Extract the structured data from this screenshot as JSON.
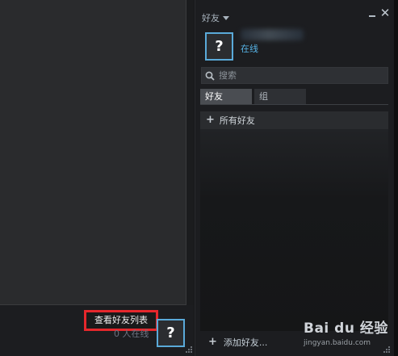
{
  "main_window": {
    "view_friends_label": "查看好友列表",
    "online_count": "0 人在线",
    "avatar_placeholder": "?"
  },
  "friends_panel": {
    "title": "好友",
    "self": {
      "avatar_placeholder": "?",
      "status": "在线"
    },
    "search": {
      "placeholder": "搜索"
    },
    "tabs": [
      {
        "label": "好友",
        "active": true
      },
      {
        "label": "组",
        "active": false
      }
    ],
    "groups": [
      {
        "label": "所有好友"
      }
    ],
    "add_friend_label": "添加好友..."
  },
  "watermark": {
    "brand": "Bai du 经验",
    "url": "jingyan.baidu.com"
  },
  "colors": {
    "accent": "#57b3e6",
    "avatar_border": "#5aaad9",
    "highlight_box": "#e5272c",
    "panel_bg": "#1c1d20"
  }
}
